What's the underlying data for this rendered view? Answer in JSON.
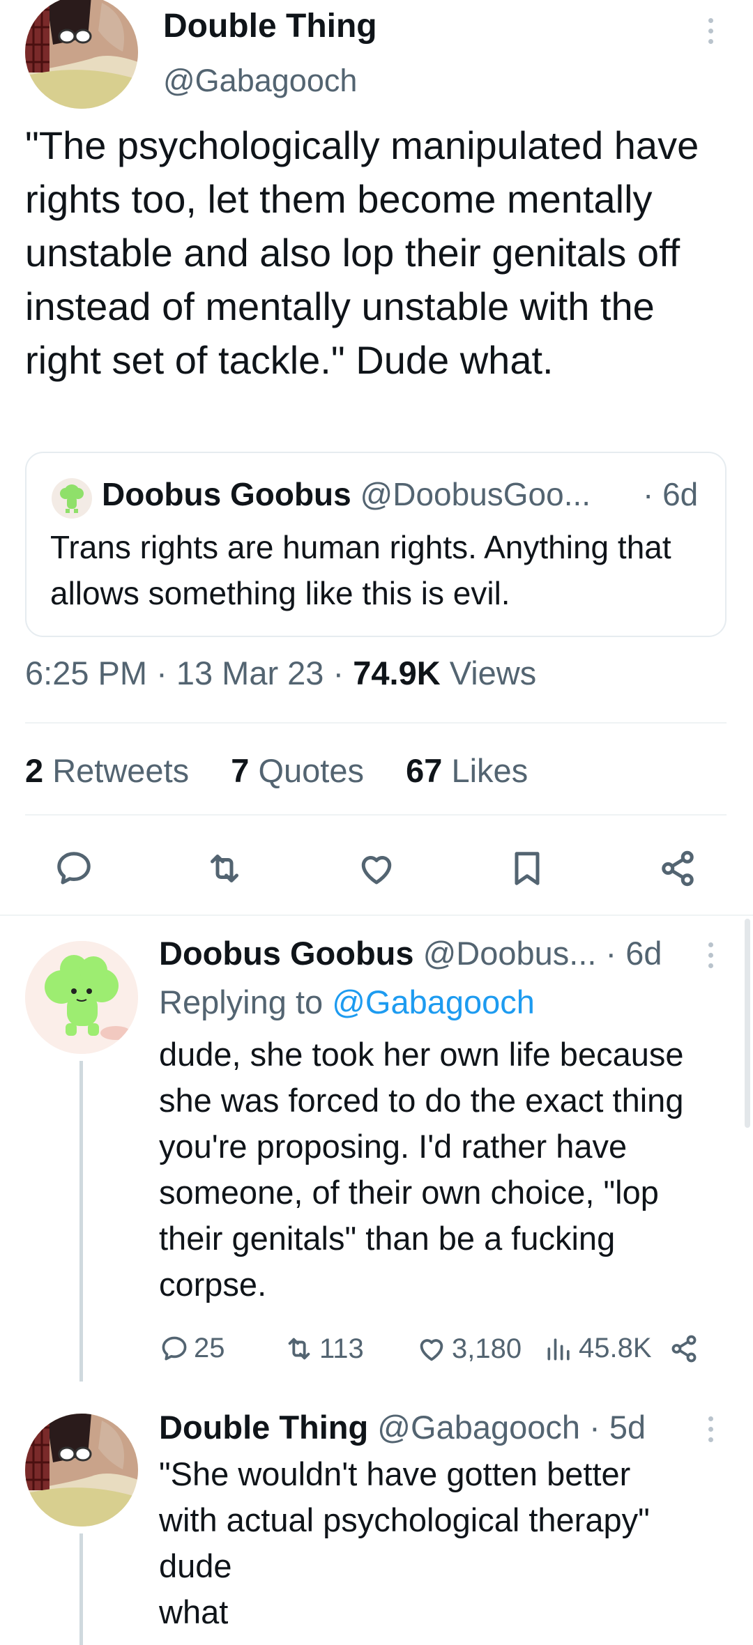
{
  "main_tweet": {
    "author_name": "Double Thing",
    "author_handle": "@Gabagooch",
    "text": "\"The psychologically manipulated have rights too, let them become mentally unstable and also lop their genitals off instead of mentally unstable with the right set of tackle.\" Dude what.",
    "quoted": {
      "author_name": "Doobus Goobus",
      "author_handle": "@DoobusGoo...",
      "time": "· 6d",
      "text": "Trans rights are human rights. Anything that allows something like this is evil."
    },
    "meta": {
      "time": "6:25 PM",
      "sep1": "·",
      "date": "13 Mar 23",
      "sep2": "·",
      "views_count": "74.9K",
      "views_label": "Views"
    },
    "stats": {
      "retweets_count": "2",
      "retweets_label": "Retweets",
      "quotes_count": "7",
      "quotes_label": "Quotes",
      "likes_count": "67",
      "likes_label": "Likes"
    },
    "actions": [
      "reply-icon",
      "retweet-icon",
      "like-icon",
      "bookmark-icon",
      "share-icon"
    ]
  },
  "replies": [
    {
      "author_name": "Doobus Goobus",
      "author_handle": "@Doobus...",
      "time": "· 6d",
      "replying_prefix": "Replying to",
      "replying_to": "@Gabagooch",
      "text_lines": [
        "dude, she took her own life because",
        "she was forced to do the exact thing",
        "you're proposing. I'd rather have",
        "someone, of their own choice, \"lop",
        "their genitals\" than be a fucking",
        "corpse."
      ],
      "replies_count": "25",
      "retweets_count": "113",
      "likes_count": "3,180",
      "views_count": "45.8K"
    },
    {
      "author_name": "Double Thing",
      "author_handle": "@Gabagooch",
      "time": "· 5d",
      "text_lines": [
        "\"She wouldn't have gotten better",
        "with actual psychological therapy\"",
        "dude",
        "what"
      ]
    }
  ],
  "colors": {
    "text": "#0f1419",
    "muted": "#536471",
    "link": "#1d9bf0",
    "divider": "#eff3f4",
    "thread_line": "#cfd9de"
  }
}
